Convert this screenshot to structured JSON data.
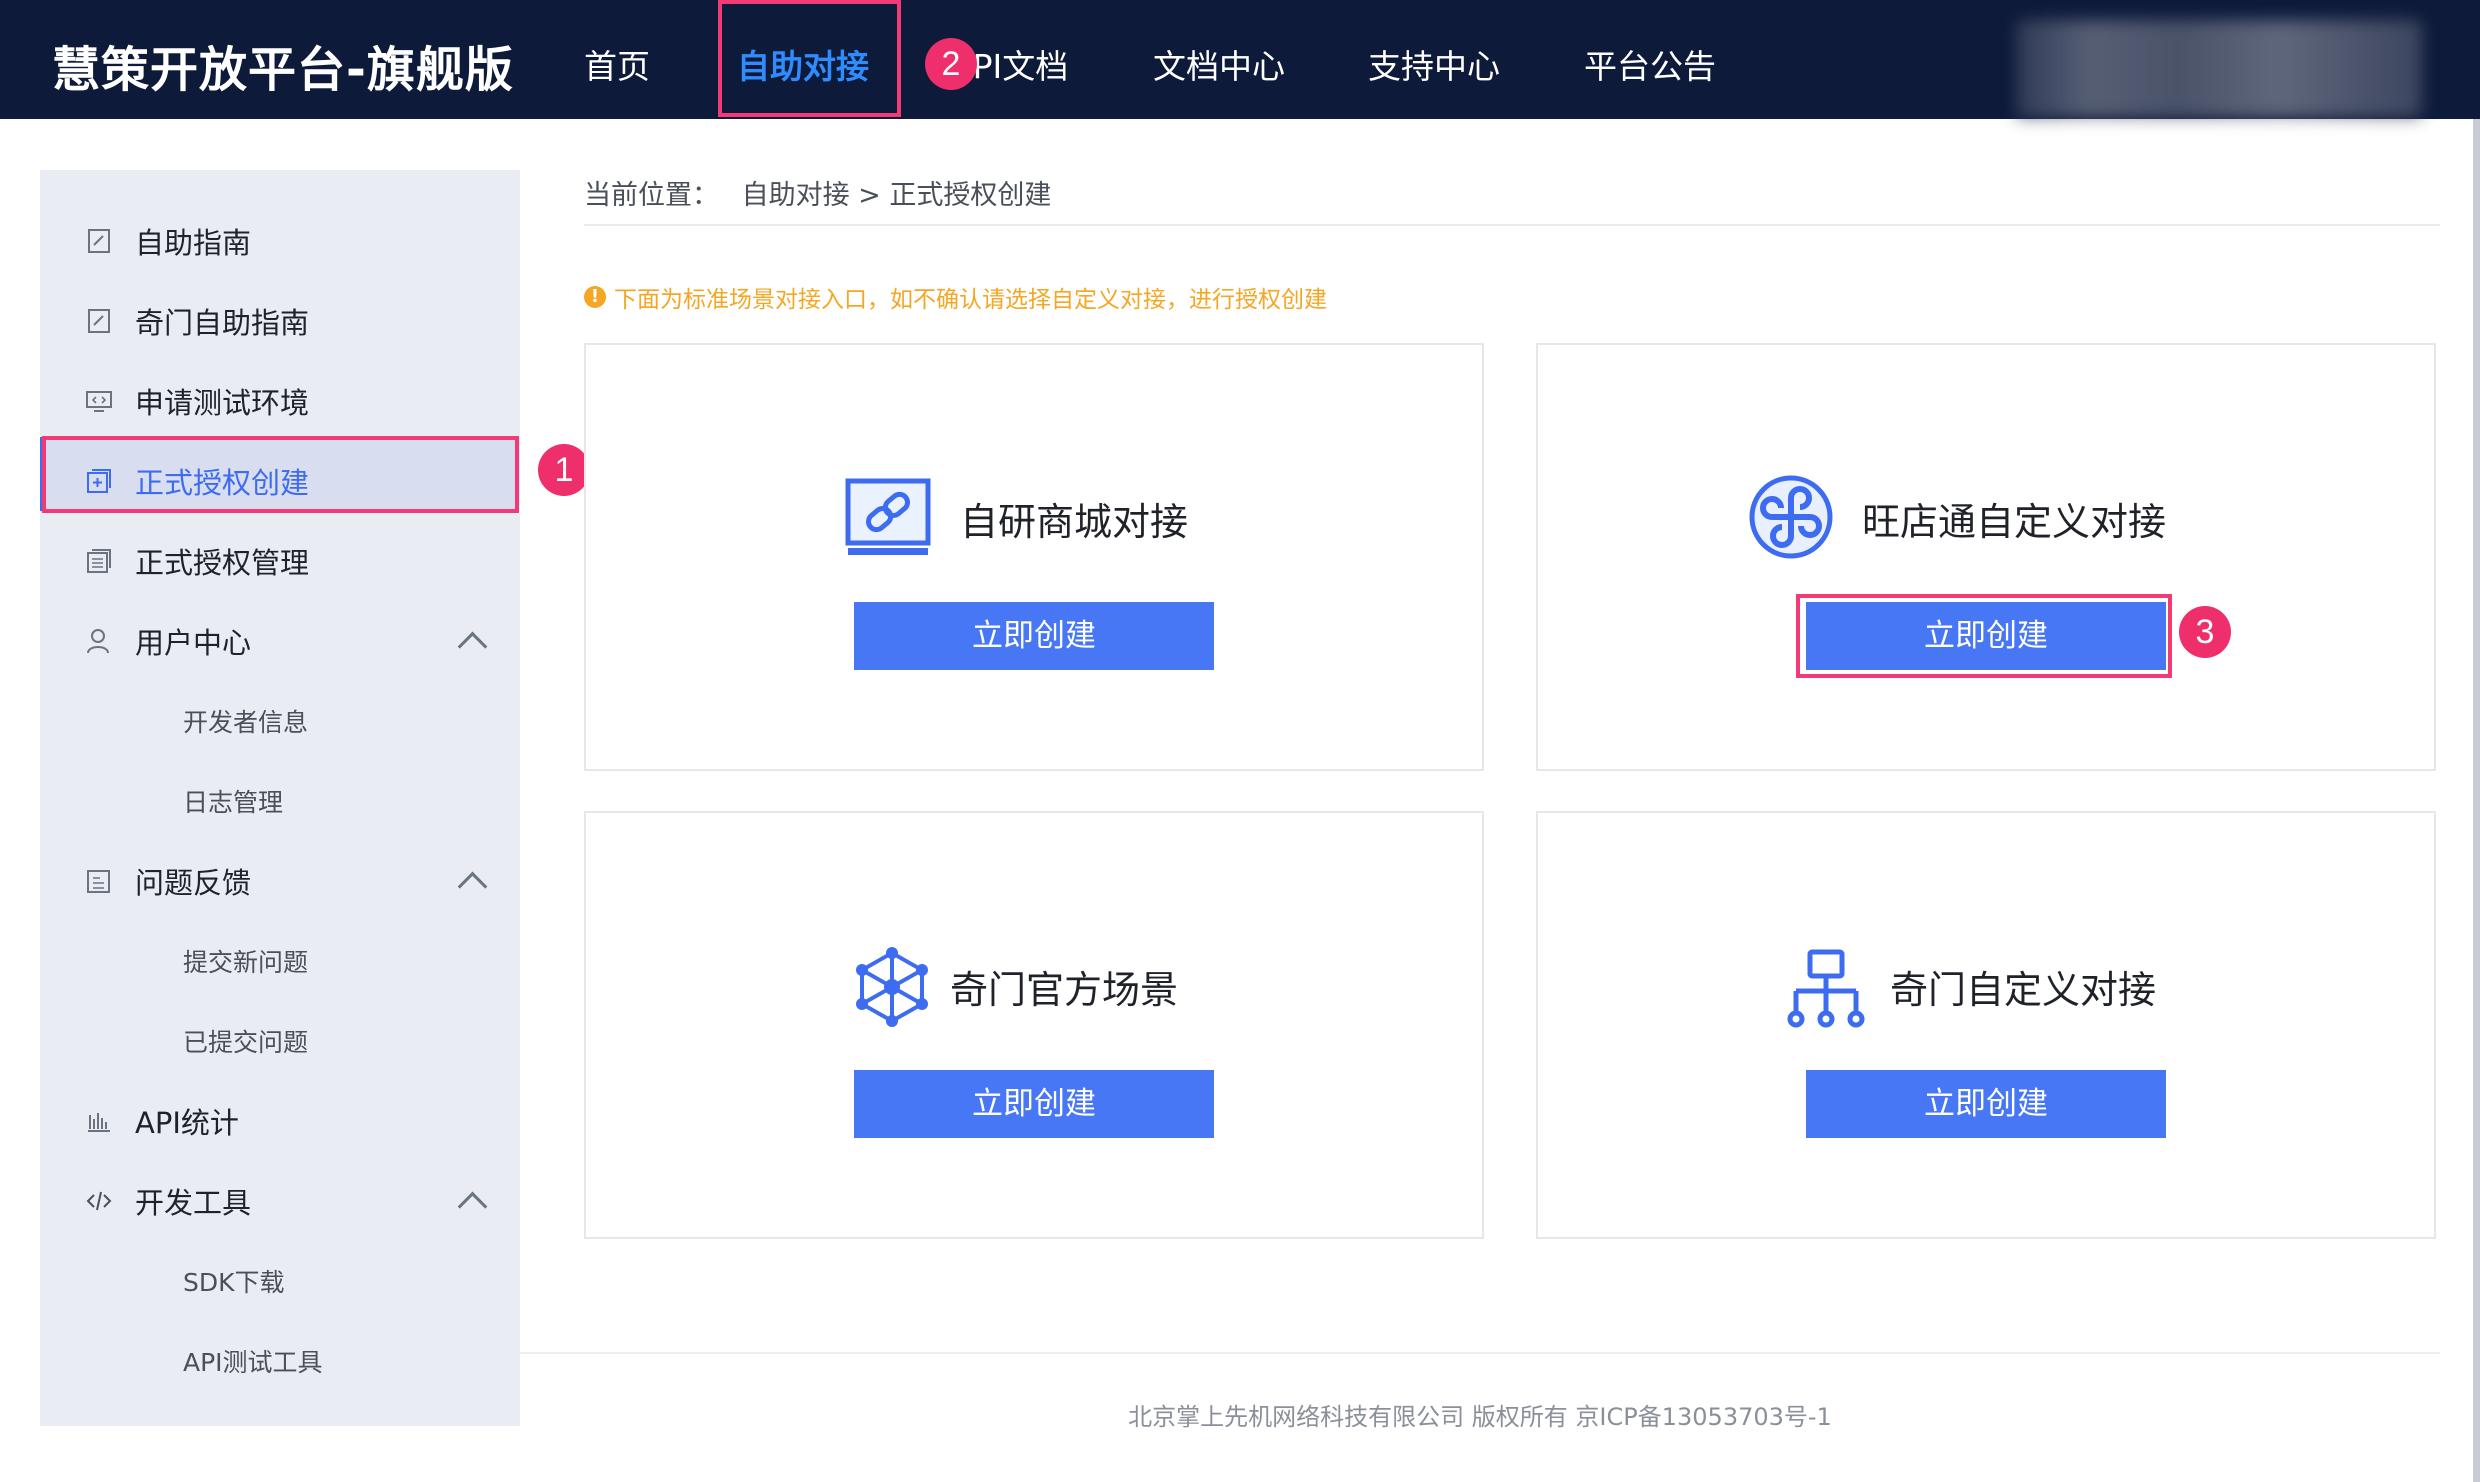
{
  "header": {
    "brand": "慧策开放平台-旗舰版",
    "nav": [
      {
        "label": "首页"
      },
      {
        "label": "自助对接"
      },
      {
        "label": "API文档"
      },
      {
        "label": "文档中心"
      },
      {
        "label": "支持中心"
      },
      {
        "label": "平台公告"
      }
    ]
  },
  "annotations": {
    "badge1": "1",
    "badge2": "2",
    "badge3": "3"
  },
  "sidebar": {
    "items": [
      {
        "label": "自助指南",
        "icon": "guide-icon"
      },
      {
        "label": "奇门自助指南",
        "icon": "guide-icon"
      },
      {
        "label": "申请测试环境",
        "icon": "monitor-code-icon"
      },
      {
        "label": "正式授权创建",
        "icon": "add-square-icon",
        "active": true
      },
      {
        "label": "正式授权管理",
        "icon": "list-icon"
      },
      {
        "label": "用户中心",
        "icon": "user-icon",
        "expanded": true
      },
      {
        "label": "开发者信息"
      },
      {
        "label": "日志管理"
      },
      {
        "label": "问题反馈",
        "icon": "edit-icon",
        "expanded": true
      },
      {
        "label": "提交新问题"
      },
      {
        "label": "已提交问题"
      },
      {
        "label": "API统计",
        "icon": "bar-chart-icon"
      },
      {
        "label": "开发工具",
        "icon": "code-icon",
        "expanded": true
      },
      {
        "label": "SDK下载"
      },
      {
        "label": "API测试工具"
      }
    ]
  },
  "breadcrumb": {
    "prefix": "当前位置：",
    "path": "自助对接 > 正式授权创建"
  },
  "notice": {
    "icon": "!",
    "text": "下面为标准场景对接入口，如不确认请选择自定义对接，进行授权创建"
  },
  "cards": [
    {
      "title": "自研商城对接",
      "icon": "link-monitor-icon",
      "button": "立即创建"
    },
    {
      "title": "旺店通自定义对接",
      "icon": "wangdiantong-logo-icon",
      "button": "立即创建"
    },
    {
      "title": "奇门官方场景",
      "icon": "network-node-icon",
      "button": "立即创建"
    },
    {
      "title": "奇门自定义对接",
      "icon": "org-tree-icon",
      "button": "立即创建"
    }
  ],
  "footer": {
    "text": "北京掌上先机网络科技有限公司 版权所有 京ICP备13053703号-1"
  },
  "colors": {
    "header_bg": "#0d1a3a",
    "nav_active": "#2f8cff",
    "button": "#4877f5",
    "highlight": "#f23a76",
    "notice": "#f5a623"
  }
}
